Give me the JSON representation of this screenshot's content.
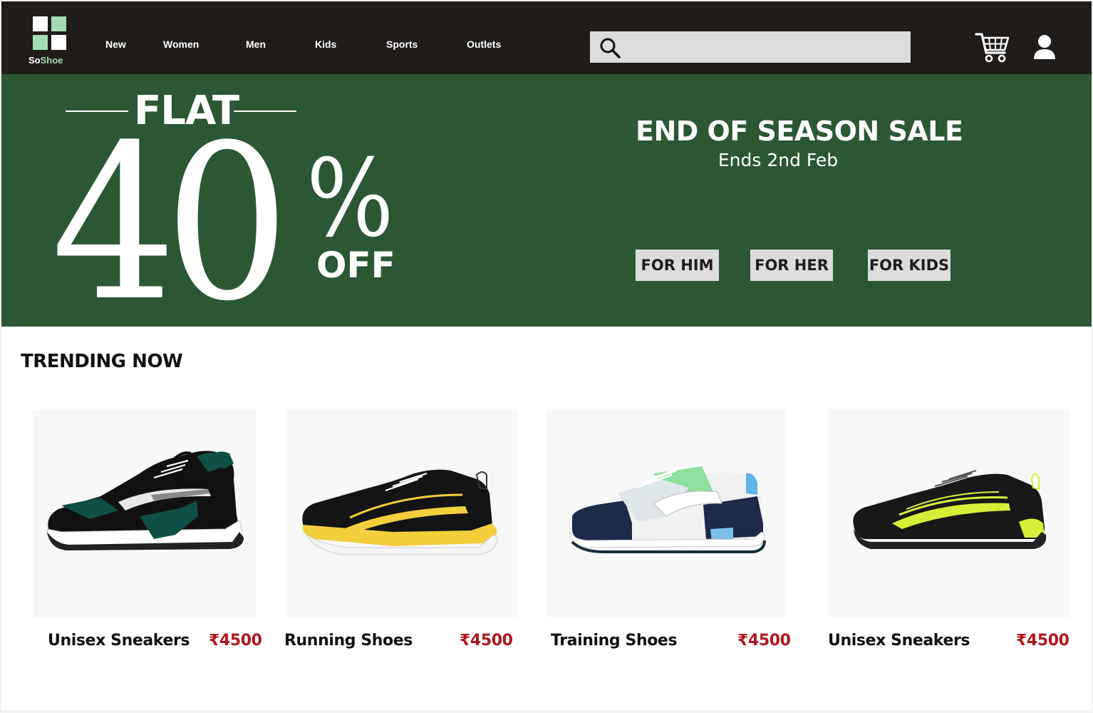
{
  "brand": {
    "name_part1": "So",
    "name_part2": "Shoe",
    "accent_color": "#a3dcb4"
  },
  "nav": {
    "links": [
      "New",
      "Women",
      "Men",
      "Kids",
      "Sports",
      "Outlets"
    ],
    "search_placeholder": "",
    "icons": [
      "search-icon",
      "cart-icon",
      "user-icon"
    ]
  },
  "hero": {
    "flat": "FLAT",
    "discount": "40",
    "percent_sign": "%",
    "off": "OFF",
    "sale_title": "END OF SEASON SALE",
    "sale_subtitle": "Ends 2nd Feb",
    "buttons": [
      "FOR HIM",
      "FOR HER",
      "FOR KIDS"
    ],
    "background_color": "#2b5735"
  },
  "trending": {
    "title": "TRENDING NOW",
    "products": [
      {
        "name": "Unisex Sneakers",
        "price": "₹4500",
        "accent": "#0f4f45"
      },
      {
        "name": "Running Shoes",
        "price": "₹4500",
        "accent": "#f2cf3d"
      },
      {
        "name": "Training Shoes",
        "price": "₹4500",
        "accent": "#8ee0a0"
      },
      {
        "name": "Unisex Sneakers",
        "price": "₹4500",
        "accent": "#d8ef3a"
      }
    ]
  },
  "colors": {
    "navbar": "#1f1c1a",
    "price": "#b0161d"
  }
}
